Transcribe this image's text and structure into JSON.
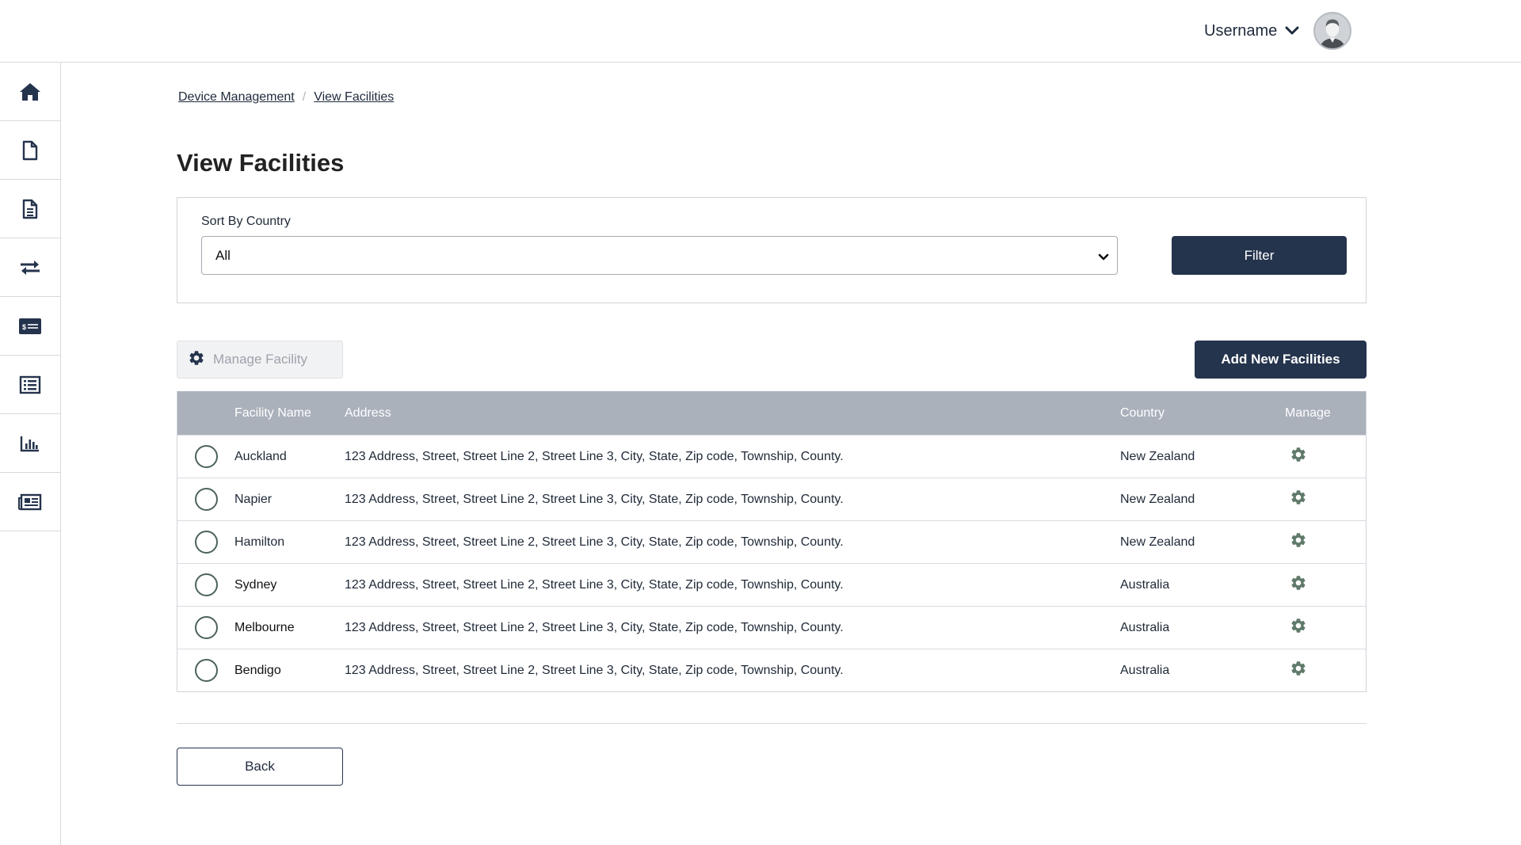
{
  "header": {
    "username": "Username",
    "user_menu_icon": "chevron-down-icon",
    "avatar_icon": "user-avatar"
  },
  "sidebar": {
    "items": [
      {
        "icon": "home-icon"
      },
      {
        "icon": "file-icon"
      },
      {
        "icon": "document-text-icon"
      },
      {
        "icon": "exchange-arrows-icon"
      },
      {
        "icon": "billing-card-icon"
      },
      {
        "icon": "list-icon"
      },
      {
        "icon": "bar-chart-icon"
      },
      {
        "icon": "newspaper-icon"
      }
    ]
  },
  "breadcrumb": {
    "items": [
      "Device Management",
      "View Facilities"
    ],
    "separator": "/"
  },
  "page": {
    "title": "View Facilities"
  },
  "filter": {
    "label": "Sort By Country",
    "selected": "All",
    "button_label": "Filter"
  },
  "toolbar": {
    "manage_label": "Manage Facility",
    "manage_icon": "gear-icon",
    "add_label": "Add New Facilities"
  },
  "table": {
    "columns": [
      "Facility Name",
      "Address",
      "Country",
      "Manage"
    ],
    "rows": [
      {
        "name": "Auckland",
        "address": "123 Address, Street, Street Line 2, Street Line 3,  City, State, Zip code, Township, County.",
        "country": "New Zealand"
      },
      {
        "name": "Napier",
        "address": "123 Address, Street, Street Line 2, Street Line 3,  City, State, Zip code, Township, County.",
        "country": "New Zealand"
      },
      {
        "name": "Hamilton",
        "address": "123 Address, Street, Street Line 2, Street Line 3,  City, State, Zip code, Township, County.",
        "country": "New Zealand"
      },
      {
        "name": "Sydney",
        "address": "123 Address, Street, Street Line 2, Street Line 3,  City, State, Zip code, Township, County.",
        "country": "Australia"
      },
      {
        "name": "Melbourne",
        "address": "123 Address, Street, Street Line 2, Street Line 3,  City, State, Zip code, Township, County.",
        "country": "Australia"
      },
      {
        "name": "Bendigo",
        "address": "123 Address, Street, Street Line 2, Street Line 3,  City, State, Zip code, Township, County.",
        "country": "Australia"
      }
    ]
  },
  "footer": {
    "back_label": "Back"
  },
  "colors": {
    "primary": "#25344d",
    "table_header": "#aab1bb",
    "gear": "#5f7a6b",
    "radio": "#4c6358"
  }
}
